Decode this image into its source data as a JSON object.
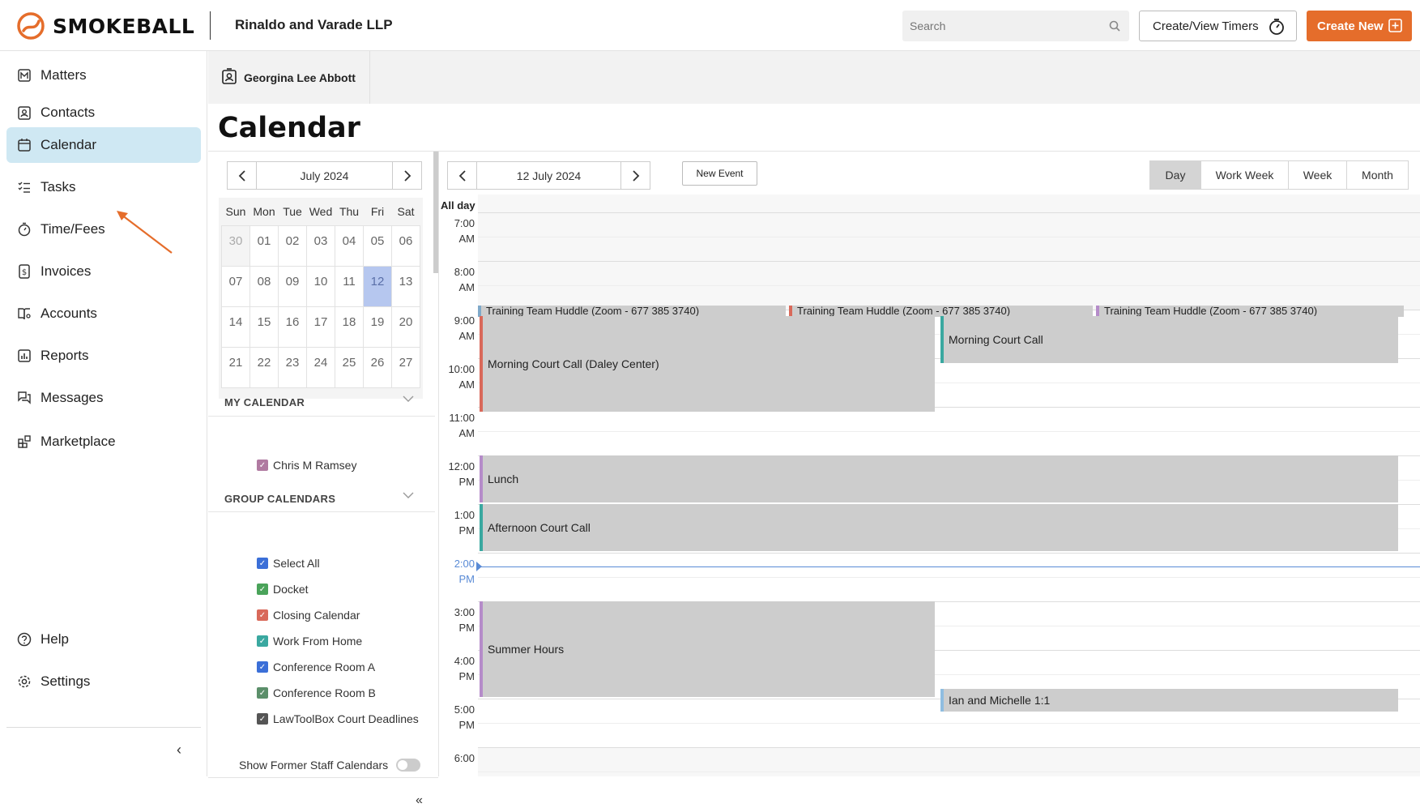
{
  "app": {
    "brand": "SMOKEBALL",
    "firm": "Rinaldo and Varade LLP"
  },
  "header": {
    "search_placeholder": "Search",
    "timers_label": "Create/View Timers",
    "create_label": "Create New"
  },
  "sidebar": {
    "items": [
      {
        "label": "Matters",
        "icon": "matters-icon"
      },
      {
        "label": "Contacts",
        "icon": "contacts-icon"
      },
      {
        "label": "Calendar",
        "icon": "calendar-icon",
        "active": true
      },
      {
        "label": "Tasks",
        "icon": "tasks-icon"
      },
      {
        "label": "Time/Fees",
        "icon": "stopwatch-icon"
      },
      {
        "label": "Invoices",
        "icon": "invoice-icon"
      },
      {
        "label": "Accounts",
        "icon": "accounts-icon"
      },
      {
        "label": "Reports",
        "icon": "reports-icon"
      },
      {
        "label": "Messages",
        "icon": "messages-icon"
      },
      {
        "label": "Marketplace",
        "icon": "marketplace-icon"
      }
    ],
    "bottom": [
      {
        "label": "Help",
        "icon": "help-icon"
      },
      {
        "label": "Settings",
        "icon": "gear-icon"
      }
    ],
    "collapse_glyph": "‹"
  },
  "tab": {
    "person": "Georgina Lee Abbott"
  },
  "page": {
    "title": "Calendar"
  },
  "mini_calendar": {
    "month_label": "July 2024",
    "weekdays": [
      "Sun",
      "Mon",
      "Tue",
      "Wed",
      "Thu",
      "Fri",
      "Sat"
    ],
    "weeks": [
      [
        "30",
        "01",
        "02",
        "03",
        "04",
        "05",
        "06"
      ],
      [
        "07",
        "08",
        "09",
        "10",
        "11",
        "12",
        "13"
      ],
      [
        "14",
        "15",
        "16",
        "17",
        "18",
        "19",
        "20"
      ],
      [
        "21",
        "22",
        "23",
        "24",
        "25",
        "26",
        "27"
      ]
    ],
    "selected": "12"
  },
  "my_calendar": {
    "heading": "MY CALENDAR",
    "items": [
      {
        "label": "Chris M Ramsey",
        "color": "#b07aa1"
      }
    ]
  },
  "group_calendars": {
    "heading": "GROUP CALENDARS",
    "items": [
      {
        "label": "Select All",
        "color": "#3b6fd8"
      },
      {
        "label": "Docket",
        "color": "#4aa35a"
      },
      {
        "label": "Closing Calendar",
        "color": "#d9695a"
      },
      {
        "label": "Work From Home",
        "color": "#3aa8a0"
      },
      {
        "label": "Conference Room A",
        "color": "#3b6fd8"
      },
      {
        "label": "Conference Room B",
        "color": "#5b8f6a"
      },
      {
        "label": "LawToolBox Court Deadlines",
        "color": "#555555"
      }
    ],
    "former_staff_label": "Show Former Staff Calendars"
  },
  "day_view": {
    "date_label": "12 July 2024",
    "new_event_label": "New Event",
    "views": [
      "Day",
      "Work Week",
      "Week",
      "Month"
    ],
    "active_view": "Day",
    "all_day_label": "All day",
    "hours": [
      [
        "7:00",
        "AM"
      ],
      [
        "8:00",
        "AM"
      ],
      [
        "9:00",
        "AM"
      ],
      [
        "10:00",
        "AM"
      ],
      [
        "11:00",
        "AM"
      ],
      [
        "12:00",
        "PM"
      ],
      [
        "1:00",
        "PM"
      ],
      [
        "2:00",
        "PM"
      ],
      [
        "3:00",
        "PM"
      ],
      [
        "4:00",
        "PM"
      ],
      [
        "5:00",
        "PM"
      ],
      [
        "6:00",
        ""
      ]
    ],
    "current_hour_index": 7,
    "events": [
      {
        "title": "Training Team Huddle (Zoom - 677 385 3740)",
        "color": "#7fa9c9"
      },
      {
        "title": "Training Team Huddle (Zoom - 677 385 3740)",
        "color": "#d9695a"
      },
      {
        "title": "Training Team Huddle (Zoom - 677 385 3740)",
        "color": "#b58cc9"
      },
      {
        "title": "Morning Court Call (Daley Center)",
        "color": "#d9695a"
      },
      {
        "title": "Morning Court Call",
        "color": "#3aa8a0"
      },
      {
        "title": "Lunch",
        "color": "#b58cc9"
      },
      {
        "title": "Afternoon Court Call",
        "color": "#3aa8a0"
      },
      {
        "title": "Summer Hours",
        "color": "#b58cc9"
      },
      {
        "title": "Ian and Michelle 1:1",
        "color": "#8fbde0"
      }
    ]
  }
}
